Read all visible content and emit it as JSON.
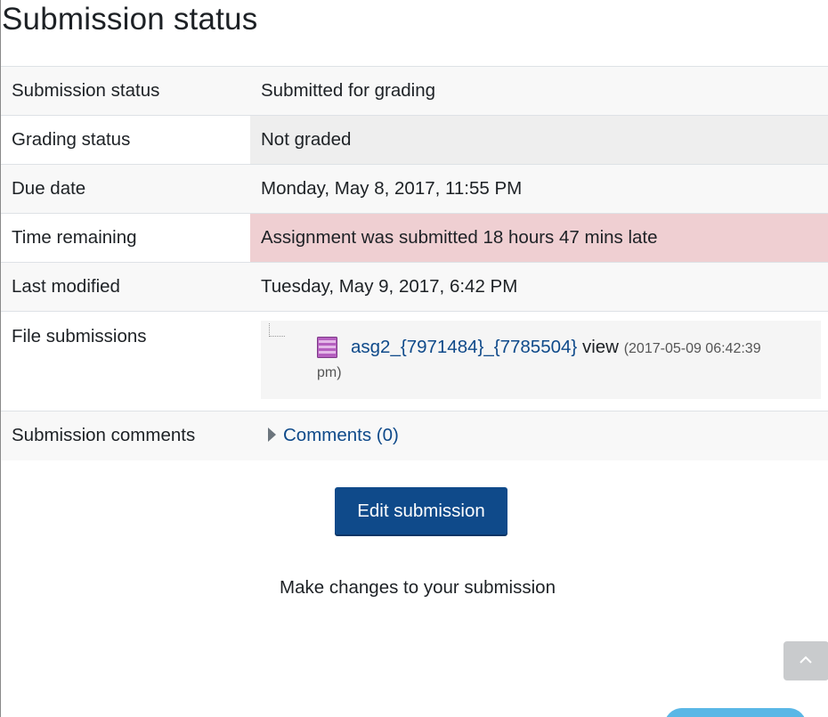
{
  "heading": "Submission status",
  "rows": {
    "submission_status": {
      "label": "Submission status",
      "value": "Submitted for grading"
    },
    "grading_status": {
      "label": "Grading status",
      "value": "Not graded"
    },
    "due_date": {
      "label": "Due date",
      "value": "Monday, May 8, 2017, 11:55 PM"
    },
    "time_remaining": {
      "label": "Time remaining",
      "value": "Assignment was submitted 18 hours 47 mins late"
    },
    "last_modified": {
      "label": "Last modified",
      "value": "Tuesday, May 9, 2017, 6:42 PM"
    },
    "file_submissions": {
      "label": "File submissions",
      "file_name": "asg2_{7971484}_{7785504}",
      "view_label": "view",
      "timestamp_part1": "(2017-05-09 06:42:39",
      "timestamp_part2": "pm)",
      "icon": "archive-file-icon"
    },
    "submission_comments": {
      "label": "Submission comments",
      "link": "Comments (0)"
    }
  },
  "edit_button_label": "Edit submission",
  "help_text": "Make changes to your submission",
  "back_to_top_icon": "chevron-up-icon",
  "colors": {
    "primary": "#0f4a8a",
    "late_highlight": "#efcfd2",
    "grey_highlight": "#eeeeee"
  }
}
